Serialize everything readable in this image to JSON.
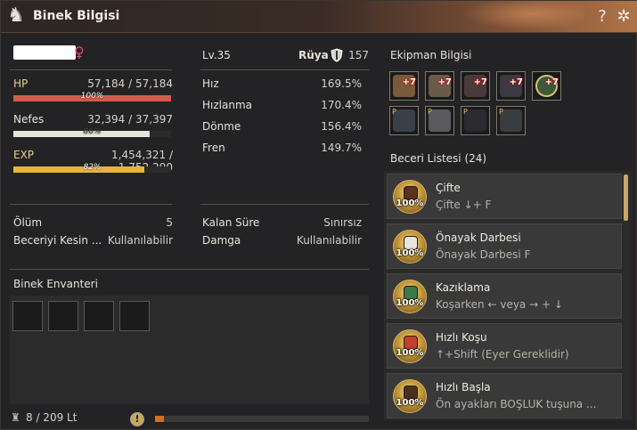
{
  "window": {
    "title": "Binek Bilgisi",
    "icon": "horse-head-icon"
  },
  "titlebar": {
    "help_label": "?",
    "settings_label": "✲"
  },
  "mount": {
    "gender_symbol": "♀",
    "level": "Lv.35",
    "stamina_label": "Rüya",
    "stamina_value": "157"
  },
  "stats": {
    "hp": {
      "label": "HP",
      "current": "57,184",
      "max": "57,184",
      "percent_label": "100%",
      "fill": 1.0,
      "color": "#d45b4b"
    },
    "nefes": {
      "label": "Nefes",
      "current": "32,394",
      "max": "37,397",
      "percent_label": "86%",
      "fill": 0.866,
      "color": "#e8e4da"
    },
    "exp": {
      "label": "EXP",
      "current": "1,454,321",
      "max": "1,752,290",
      "percent_label": "82%",
      "fill": 0.83,
      "color": "#e8b43c"
    },
    "slash": "/"
  },
  "speed": {
    "hiz_label": "Hız",
    "hiz_value": "169.5%",
    "hizlanma_label": "Hızlanma",
    "hizlanma_value": "170.4%",
    "donme_label": "Dönme",
    "donme_value": "156.4%",
    "fren_label": "Fren",
    "fren_value": "149.7%"
  },
  "info": {
    "olum_label": "Ölüm",
    "olum_value": "5",
    "kalan_label": "Kalan Süre",
    "kalan_value": "Sınırsız",
    "beceri_label": "Beceriyi Kesin ...",
    "beceri_value": "Kullanılabilir",
    "damga_label": "Damga",
    "damga_value": "Kullanılabilir"
  },
  "inventory": {
    "title": "Binek Envanteri",
    "weight": "8 / 209 Lt",
    "alert_label": "!",
    "capacity_fill": 0.04
  },
  "equipment": {
    "title": "Ekipman Bilgisi",
    "row1": [
      {
        "plus": "+7",
        "color": "#7a5a3a"
      },
      {
        "plus": "+7",
        "color": "#6a5a4a"
      },
      {
        "plus": "+7",
        "color": "#4a3a3a"
      },
      {
        "plus": "+7",
        "color": "#3a3a40"
      },
      {
        "plus": "+7",
        "color": "#3a5a3a"
      }
    ],
    "row2": [
      {
        "mark": "P",
        "color": "#3a4048"
      },
      {
        "mark": "P",
        "color": "#5a5a5e"
      },
      {
        "mark": "P",
        "color": "#2a2a30"
      },
      {
        "mark": "P",
        "color": "#3a3c40"
      }
    ]
  },
  "skills": {
    "title": "Beceri Listesi",
    "count": "(24)",
    "items": [
      {
        "name": "Çifte",
        "command": "Çifte ↓+ F",
        "percent": "100%"
      },
      {
        "name": "Önayak Darbesi",
        "command": "Önayak Darbesi F",
        "percent": "100%"
      },
      {
        "name": "Kazıklama",
        "command": "Koşarken ← veya → + ↓",
        "percent": "100%"
      },
      {
        "name": "Hızlı Koşu",
        "command": "↑+Shift (Eyer Gereklidir)",
        "percent": "100%"
      },
      {
        "name": "Hızlı Başla",
        "command": "Ön ayakları BOŞLUK tuşuna ...",
        "percent": "100%"
      }
    ]
  }
}
